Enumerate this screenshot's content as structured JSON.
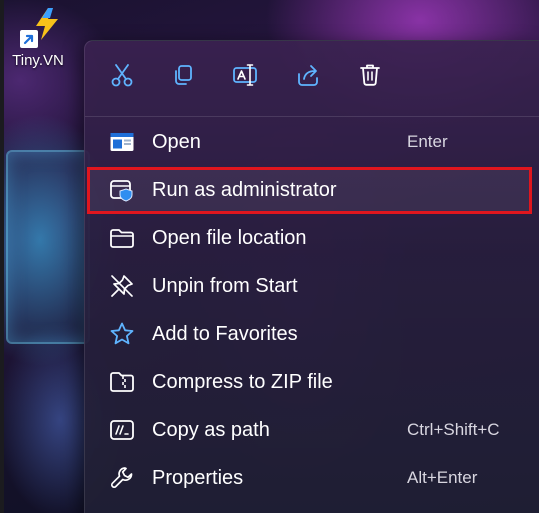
{
  "desktop": {
    "shortcut_label": "Tiny.VN",
    "shortcut_icon": "lightning-app-icon",
    "overlay_icon": "shortcut-arrow-icon"
  },
  "context_menu": {
    "toolbar": [
      {
        "name": "cut",
        "icon": "scissors-icon"
      },
      {
        "name": "copy",
        "icon": "copy-icon"
      },
      {
        "name": "rename",
        "icon": "rename-icon"
      },
      {
        "name": "share",
        "icon": "share-icon"
      },
      {
        "name": "delete",
        "icon": "trash-icon"
      }
    ],
    "items": [
      {
        "label": "Open",
        "shortcut": "Enter",
        "icon": "window-icon"
      },
      {
        "label": "Run as administrator",
        "shortcut": "",
        "icon": "shield-window-icon",
        "highlighted": true
      },
      {
        "label": "Open file location",
        "shortcut": "",
        "icon": "folder-icon"
      },
      {
        "label": "Unpin from Start",
        "shortcut": "",
        "icon": "unpin-icon"
      },
      {
        "label": "Add to Favorites",
        "shortcut": "",
        "icon": "star-icon"
      },
      {
        "label": "Compress to ZIP file",
        "shortcut": "",
        "icon": "zip-folder-icon"
      },
      {
        "label": "Copy as path",
        "shortcut": "Ctrl+Shift+C",
        "icon": "path-icon"
      },
      {
        "label": "Properties",
        "shortcut": "Alt+Enter",
        "icon": "wrench-icon"
      }
    ]
  },
  "colors": {
    "highlight_border": "#e0161e",
    "icon_accent": "#5fb4ff",
    "menu_text": "#ffffff"
  }
}
